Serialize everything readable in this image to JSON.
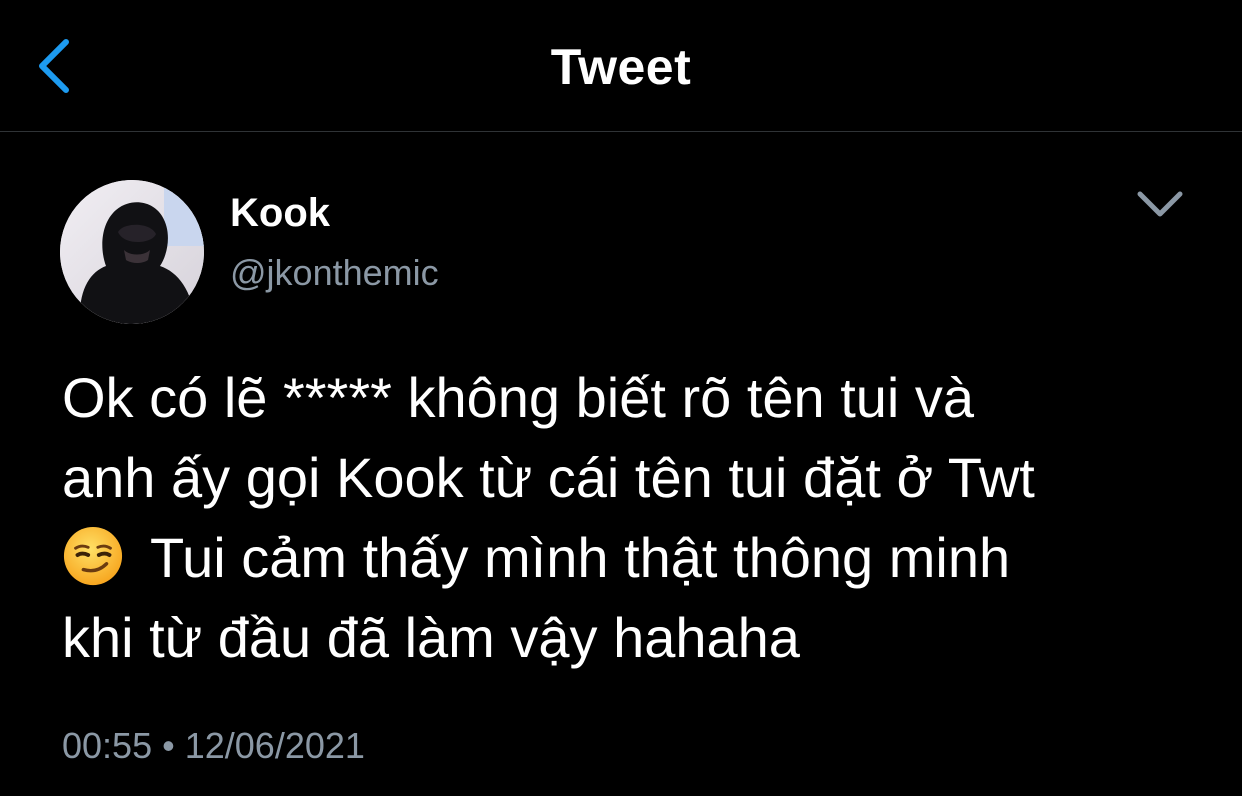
{
  "header": {
    "title": "Tweet",
    "back_icon": "chevron-left-icon"
  },
  "colors": {
    "background": "#000000",
    "accent": "#1d9bf0",
    "secondary_text": "#8b98a5",
    "primary_text": "#ffffff",
    "divider": "#2f3336"
  },
  "tweet": {
    "author": {
      "display_name": "Kook",
      "handle": "@jkonthemic"
    },
    "more_icon": "chevron-down-icon",
    "text_lines": [
      "Ok có lẽ ***** không biết rõ tên tui và",
      "anh ấy gọi Kook từ cái tên tui đặt ở Twt",
      "Tui cảm thấy mình thật thông minh",
      "khi từ đầu đã làm vậy hahaha"
    ],
    "emoji": "smirking-face-emoji",
    "time": "00:55",
    "separator": "•",
    "date": "12/06/2021"
  }
}
